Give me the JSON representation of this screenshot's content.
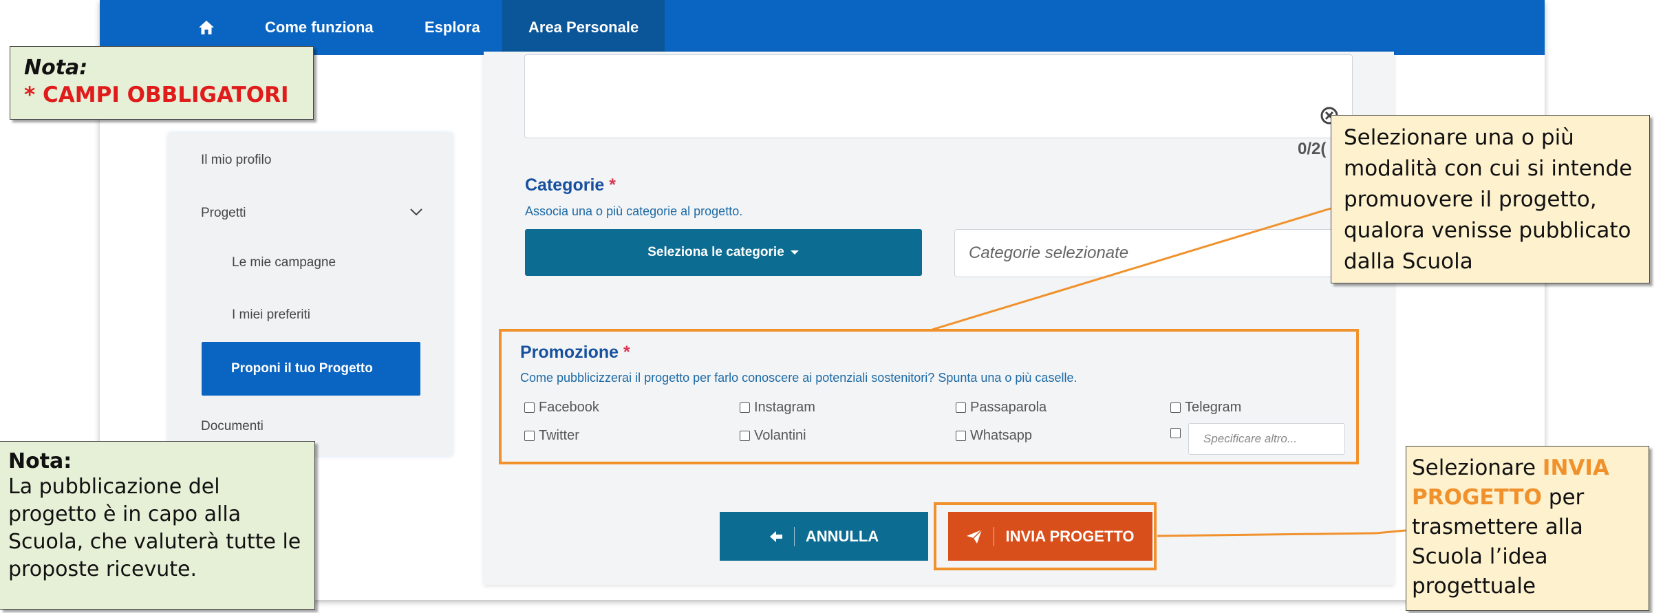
{
  "colors": {
    "nav_blue": "#0a64c1",
    "teal_button": "#0d6c92",
    "orange_button": "#d94f1b",
    "highlight_orange": "#f0912c",
    "required_red": "#d9364f"
  },
  "navbar": {
    "home_icon": "home-icon",
    "links": [
      "Come funziona",
      "Esplora",
      "Area Personale"
    ],
    "active": "Area Personale"
  },
  "sidebar": {
    "items": {
      "profilo": "Il mio profilo",
      "progetti": "Progetti",
      "campagne": "Le mie campagne",
      "preferiti": "I miei preferiti",
      "proponi": "Proponi il tuo Progetto",
      "documenti": "Documenti"
    }
  },
  "form": {
    "textarea_counter": "0/2(",
    "categorie": {
      "title": "Categorie",
      "required_mark": "*",
      "hint": "Associa una o più categorie al progetto.",
      "button": "Seleziona le categorie",
      "selected_placeholder": "Categorie selezionate"
    },
    "promozione": {
      "title": "Promozione",
      "required_mark": "*",
      "hint": "Come pubblicizzerai il progetto per farlo conoscere ai potenziali sostenitori? Spunta una o più caselle.",
      "options": [
        "Facebook",
        "Instagram",
        "Passaparola",
        "Telegram",
        "Twitter",
        "Volantini",
        "Whatsapp"
      ],
      "altro_placeholder": "Specificare altro..."
    },
    "buttons": {
      "annulla": "ANNULLA",
      "invia": "INVIA PROGETTO"
    }
  },
  "callouts": {
    "nota_top": {
      "title": "Nota:",
      "body": "* CAMPI OBBLIGATORI"
    },
    "nota_bottom": {
      "title": "Nota:",
      "body": "La pubblicazione del progetto è in capo alla Scuola, che valuterà tutte le proposte ricevute."
    },
    "promozione_hint": "Selezionare una o più modalità con cui si intende promuovere il progetto, qualora venisse pubblicato dalla Scuola",
    "invia_hint": {
      "prefix": "Selezionare ",
      "highlight": "INVIA PROGETTO",
      "suffix": " per trasmettere alla Scuola l’idea progettuale"
    }
  }
}
